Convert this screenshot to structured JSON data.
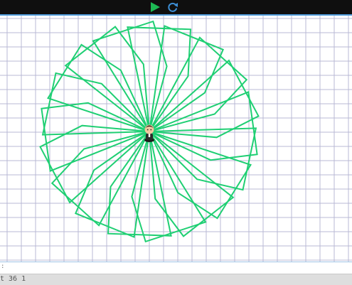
{
  "toolbar": {
    "run_icon": "play-icon",
    "reset_icon": "refresh-icon",
    "run_color": "#1db954",
    "reset_color": "#3d8fd6"
  },
  "canvas": {
    "grid_color": "#b9b9d4",
    "grid_spacing": 20,
    "line_color": "#1fcf73",
    "sprite": "turtle-character-icon"
  },
  "status": {
    "text": "t 36 1",
    "mark": ":"
  }
}
